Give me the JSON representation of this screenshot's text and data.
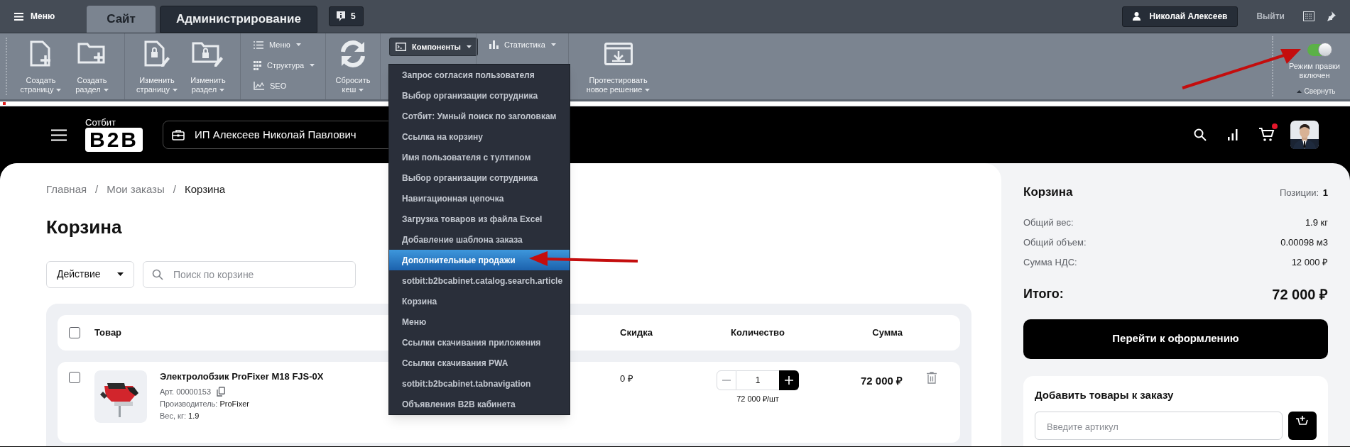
{
  "admin_bar": {
    "menu_label": "Меню",
    "tabs": [
      {
        "label": "Сайт",
        "selected": true
      },
      {
        "label": "Администрирование",
        "selected": false
      }
    ],
    "notifications": "5",
    "user": "Николай Алексеев",
    "logout": "Выйти"
  },
  "toolbar": {
    "groups": [
      {
        "kind": "big",
        "items": [
          {
            "lines": [
              "Создать",
              "страницу"
            ],
            "dropdown": true
          },
          {
            "lines": [
              "Создать",
              "раздел"
            ],
            "dropdown": true
          }
        ]
      },
      {
        "kind": "big",
        "items": [
          {
            "lines": [
              "Изменить",
              "страницу"
            ],
            "dropdown": true
          },
          {
            "lines": [
              "Изменить",
              "раздел"
            ],
            "dropdown": true
          }
        ]
      },
      {
        "kind": "list",
        "items": [
          {
            "label": "Меню",
            "dropdown": true
          },
          {
            "label": "Структура",
            "dropdown": true
          },
          {
            "label": "SEO",
            "dropdown": false
          }
        ]
      },
      {
        "kind": "big",
        "items": [
          {
            "lines": [
              "Сбросить",
              "кеш"
            ],
            "dropdown": true
          }
        ]
      },
      {
        "kind": "list",
        "items": [
          {
            "label": "Компоненты",
            "dropdown": true,
            "expanded": true
          }
        ]
      },
      {
        "kind": "list",
        "items": [
          {
            "label": "Статистика",
            "dropdown": true,
            "expanded": false
          }
        ]
      },
      {
        "kind": "big",
        "items": [
          {
            "lines": [
              "Протестировать",
              "новое решение"
            ],
            "dropdown": true
          }
        ]
      }
    ],
    "edit_mode": {
      "lines": [
        "Режим правки",
        "включен"
      ],
      "on": true
    },
    "collapse": "Свернуть"
  },
  "components_menu": [
    {
      "label": "Запрос согласия пользователя",
      "selected": false
    },
    {
      "label": "Выбор организации сотрудника",
      "selected": false
    },
    {
      "label": "Сотбит: Умный поиск по заголовкам",
      "selected": false
    },
    {
      "label": "Ссылка на корзину",
      "selected": false
    },
    {
      "label": "Имя пользователя с тултипом",
      "selected": false
    },
    {
      "label": "Выбор организации сотрудника",
      "selected": false
    },
    {
      "label": "Навигационная цепочка",
      "selected": false
    },
    {
      "label": "Загрузка товаров из файла Excel",
      "selected": false
    },
    {
      "label": "Добавление шаблона заказа",
      "selected": false
    },
    {
      "label": "Дополнительные продажи",
      "selected": true
    },
    {
      "label": "sotbit:b2bcabinet.catalog.search.article",
      "selected": false
    },
    {
      "label": "Корзина",
      "selected": false
    },
    {
      "label": "Меню",
      "selected": false
    },
    {
      "label": "Ссылки скачивания приложения",
      "selected": false
    },
    {
      "label": "Ссылки скачивания PWA",
      "selected": false
    },
    {
      "label": "sotbit:b2bcabinet.tabnavigation",
      "selected": false
    },
    {
      "label": "Объявления B2B кабинета",
      "selected": false
    }
  ],
  "site_header": {
    "logo_caption": "Сотбит",
    "logo_text": "B2B",
    "company": "ИП Алексеев Николай Павлович",
    "cart_badge": true
  },
  "breadcrumbs": [
    "Главная",
    "Мои заказы",
    "Корзина"
  ],
  "breadcrumb_separators": [
    "/",
    "/"
  ],
  "title": "Корзина",
  "actions": {
    "action_label": "Действие",
    "search_placeholder": "Поиск по корзине"
  },
  "table": {
    "select_all_checked": false,
    "columns": [
      "Товар",
      "Скидка",
      "Количество",
      "Сумма"
    ],
    "rows": [
      {
        "checked": false,
        "name": "Электролобзик ProFixer M18 FJS-0X",
        "article_label": "Арт.",
        "article": "00000153",
        "manufacturer_label": "Производитель:",
        "manufacturer": "ProFixer",
        "weight_label": "Вес, кг:",
        "weight": "1.9",
        "discount": "0 ₽",
        "quantity": "1",
        "unit_price": "72 000 ₽/шт",
        "sum": "72 000 ₽"
      }
    ]
  },
  "summary": {
    "title": "Корзина",
    "positions_label": "Позиции:",
    "positions": "1",
    "rows": [
      {
        "label": "Общий вес:",
        "value": "1.9 кг"
      },
      {
        "label": "Общий объем:",
        "value": "0.00098 м3"
      },
      {
        "label": "Сумма НДС:",
        "value": "12 000 ₽"
      }
    ],
    "total_label": "Итого:",
    "total": "72 000 ₽",
    "checkout": "Перейти к оформлению",
    "add_items": {
      "title": "Добавить товары к заказу",
      "placeholder": "Введите артикул"
    }
  }
}
